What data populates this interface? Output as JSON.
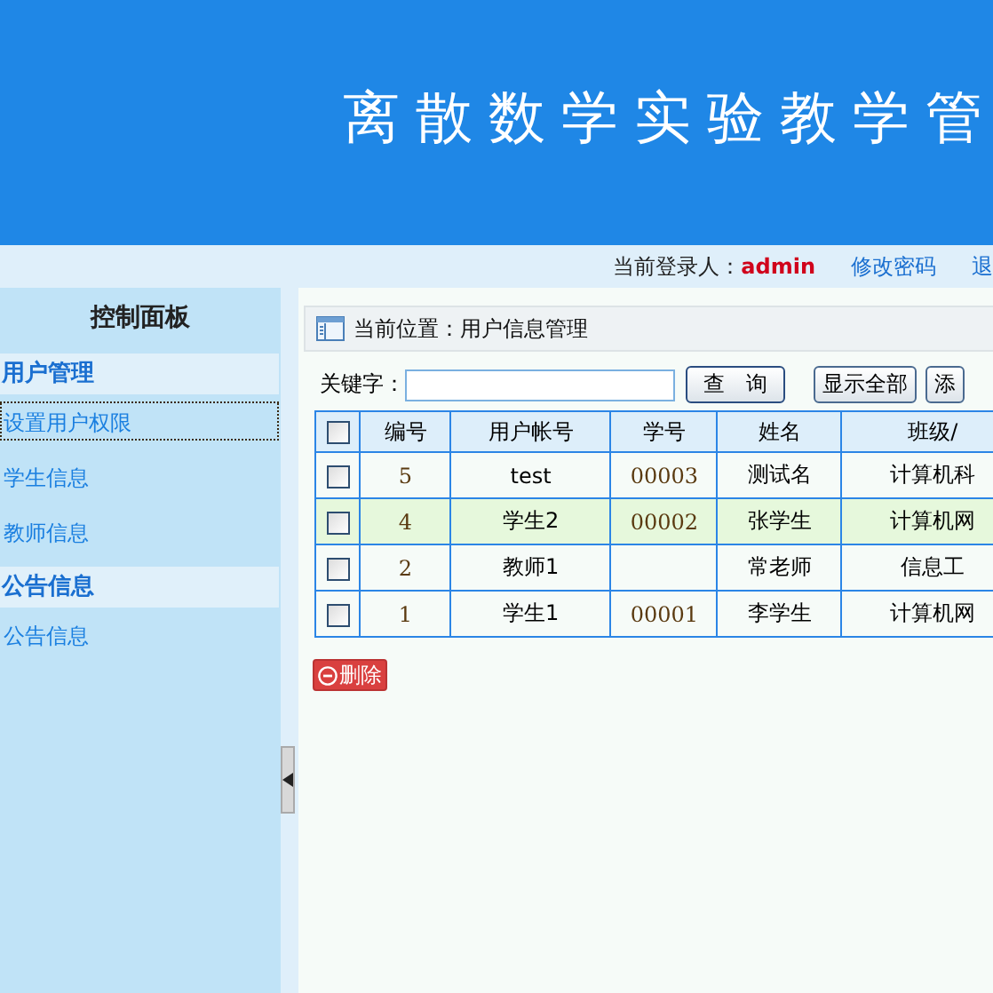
{
  "header": {
    "title": "离散数学实验教学管"
  },
  "top_bar": {
    "login_label": "当前登录人：",
    "user": "admin",
    "links": [
      "修改密码",
      "退"
    ]
  },
  "sidebar": {
    "title": "控制面板",
    "groups": [
      {
        "title": "用户管理",
        "items": [
          {
            "label": "设置用户权限",
            "selected": true
          },
          {
            "label": "学生信息",
            "selected": false
          },
          {
            "label": "教师信息",
            "selected": false
          }
        ]
      },
      {
        "title": "公告信息",
        "items": [
          {
            "label": "公告信息",
            "selected": false
          }
        ]
      }
    ]
  },
  "breadcrumb": "当前位置：用户信息管理",
  "search": {
    "label": "关键字：",
    "buttons": [
      "查　询",
      "显示全部",
      "添"
    ]
  },
  "table": {
    "all_checked": false,
    "columns": [
      "编号",
      "用户帐号",
      "学号",
      "姓名",
      "班级/"
    ],
    "rows": [
      {
        "checked": false,
        "highlighted": false,
        "cells": [
          "5",
          "test",
          "00003",
          "测试名",
          "计算机科"
        ]
      },
      {
        "checked": false,
        "highlighted": true,
        "cells": [
          "4",
          "学生2",
          "00002",
          "张学生",
          "计算机网"
        ]
      },
      {
        "checked": false,
        "highlighted": false,
        "cells": [
          "2",
          "教师1",
          "",
          "常老师",
          "信息工"
        ]
      },
      {
        "checked": false,
        "highlighted": false,
        "cells": [
          "1",
          "学生1",
          "00001",
          "李学生",
          "计算机网"
        ]
      }
    ]
  },
  "delete_button": "删除"
}
